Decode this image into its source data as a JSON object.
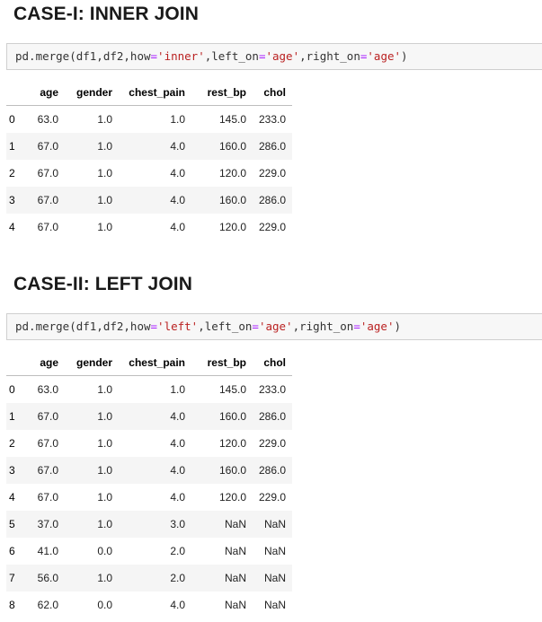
{
  "sections": [
    {
      "title": "CASE-I: INNER JOIN",
      "code": {
        "prefix": "pd.merge(df1,df2,how",
        "op1": "=",
        "how_str": "'inner'",
        "mid": ",left_on",
        "op2": "=",
        "left_str": "'age'",
        "mid2": ",right_on",
        "op3": "=",
        "right_str": "'age'",
        "suffix": ")"
      },
      "table": {
        "columns": [
          "age",
          "gender",
          "chest_pain",
          "rest_bp",
          "chol"
        ],
        "rows": [
          {
            "index": "0",
            "cells": [
              "63.0",
              "1.0",
              "1.0",
              "145.0",
              "233.0"
            ]
          },
          {
            "index": "1",
            "cells": [
              "67.0",
              "1.0",
              "4.0",
              "160.0",
              "286.0"
            ]
          },
          {
            "index": "2",
            "cells": [
              "67.0",
              "1.0",
              "4.0",
              "120.0",
              "229.0"
            ]
          },
          {
            "index": "3",
            "cells": [
              "67.0",
              "1.0",
              "4.0",
              "160.0",
              "286.0"
            ]
          },
          {
            "index": "4",
            "cells": [
              "67.0",
              "1.0",
              "4.0",
              "120.0",
              "229.0"
            ]
          }
        ]
      }
    },
    {
      "title": "CASE-II: LEFT JOIN",
      "code": {
        "prefix": "pd.merge(df1,df2,how",
        "op1": "=",
        "how_str": "'left'",
        "mid": ",left_on",
        "op2": "=",
        "left_str": "'age'",
        "mid2": ",right_on",
        "op3": "=",
        "right_str": "'age'",
        "suffix": ")"
      },
      "table": {
        "columns": [
          "age",
          "gender",
          "chest_pain",
          "rest_bp",
          "chol"
        ],
        "rows": [
          {
            "index": "0",
            "cells": [
              "63.0",
              "1.0",
              "1.0",
              "145.0",
              "233.0"
            ]
          },
          {
            "index": "1",
            "cells": [
              "67.0",
              "1.0",
              "4.0",
              "160.0",
              "286.0"
            ]
          },
          {
            "index": "2",
            "cells": [
              "67.0",
              "1.0",
              "4.0",
              "120.0",
              "229.0"
            ]
          },
          {
            "index": "3",
            "cells": [
              "67.0",
              "1.0",
              "4.0",
              "160.0",
              "286.0"
            ]
          },
          {
            "index": "4",
            "cells": [
              "67.0",
              "1.0",
              "4.0",
              "120.0",
              "229.0"
            ]
          },
          {
            "index": "5",
            "cells": [
              "37.0",
              "1.0",
              "3.0",
              "NaN",
              "NaN"
            ]
          },
          {
            "index": "6",
            "cells": [
              "41.0",
              "0.0",
              "2.0",
              "NaN",
              "NaN"
            ]
          },
          {
            "index": "7",
            "cells": [
              "56.0",
              "1.0",
              "2.0",
              "NaN",
              "NaN"
            ]
          },
          {
            "index": "8",
            "cells": [
              "62.0",
              "0.0",
              "4.0",
              "NaN",
              "NaN"
            ]
          }
        ]
      }
    }
  ]
}
